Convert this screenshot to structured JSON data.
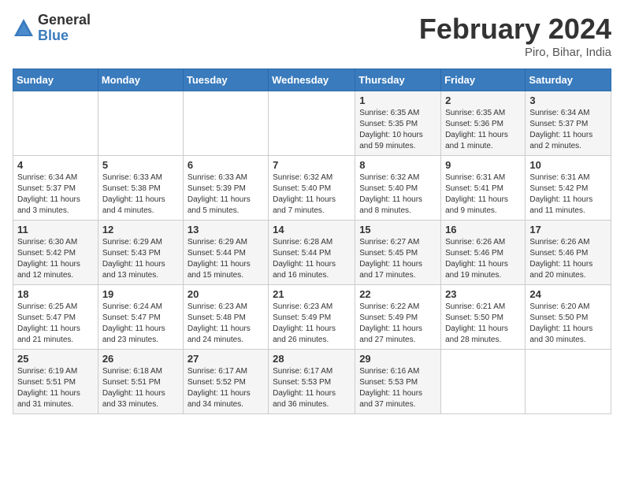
{
  "header": {
    "logo_general": "General",
    "logo_blue": "Blue",
    "title": "February 2024",
    "subtitle": "Piro, Bihar, India"
  },
  "days_of_week": [
    "Sunday",
    "Monday",
    "Tuesday",
    "Wednesday",
    "Thursday",
    "Friday",
    "Saturday"
  ],
  "weeks": [
    [
      {
        "day": "",
        "sunrise": "",
        "sunset": "",
        "daylight": ""
      },
      {
        "day": "",
        "sunrise": "",
        "sunset": "",
        "daylight": ""
      },
      {
        "day": "",
        "sunrise": "",
        "sunset": "",
        "daylight": ""
      },
      {
        "day": "",
        "sunrise": "",
        "sunset": "",
        "daylight": ""
      },
      {
        "day": "1",
        "sunrise": "Sunrise: 6:35 AM",
        "sunset": "Sunset: 5:35 PM",
        "daylight": "Daylight: 10 hours and 59 minutes."
      },
      {
        "day": "2",
        "sunrise": "Sunrise: 6:35 AM",
        "sunset": "Sunset: 5:36 PM",
        "daylight": "Daylight: 11 hours and 1 minute."
      },
      {
        "day": "3",
        "sunrise": "Sunrise: 6:34 AM",
        "sunset": "Sunset: 5:37 PM",
        "daylight": "Daylight: 11 hours and 2 minutes."
      }
    ],
    [
      {
        "day": "4",
        "sunrise": "Sunrise: 6:34 AM",
        "sunset": "Sunset: 5:37 PM",
        "daylight": "Daylight: 11 hours and 3 minutes."
      },
      {
        "day": "5",
        "sunrise": "Sunrise: 6:33 AM",
        "sunset": "Sunset: 5:38 PM",
        "daylight": "Daylight: 11 hours and 4 minutes."
      },
      {
        "day": "6",
        "sunrise": "Sunrise: 6:33 AM",
        "sunset": "Sunset: 5:39 PM",
        "daylight": "Daylight: 11 hours and 5 minutes."
      },
      {
        "day": "7",
        "sunrise": "Sunrise: 6:32 AM",
        "sunset": "Sunset: 5:40 PM",
        "daylight": "Daylight: 11 hours and 7 minutes."
      },
      {
        "day": "8",
        "sunrise": "Sunrise: 6:32 AM",
        "sunset": "Sunset: 5:40 PM",
        "daylight": "Daylight: 11 hours and 8 minutes."
      },
      {
        "day": "9",
        "sunrise": "Sunrise: 6:31 AM",
        "sunset": "Sunset: 5:41 PM",
        "daylight": "Daylight: 11 hours and 9 minutes."
      },
      {
        "day": "10",
        "sunrise": "Sunrise: 6:31 AM",
        "sunset": "Sunset: 5:42 PM",
        "daylight": "Daylight: 11 hours and 11 minutes."
      }
    ],
    [
      {
        "day": "11",
        "sunrise": "Sunrise: 6:30 AM",
        "sunset": "Sunset: 5:42 PM",
        "daylight": "Daylight: 11 hours and 12 minutes."
      },
      {
        "day": "12",
        "sunrise": "Sunrise: 6:29 AM",
        "sunset": "Sunset: 5:43 PM",
        "daylight": "Daylight: 11 hours and 13 minutes."
      },
      {
        "day": "13",
        "sunrise": "Sunrise: 6:29 AM",
        "sunset": "Sunset: 5:44 PM",
        "daylight": "Daylight: 11 hours and 15 minutes."
      },
      {
        "day": "14",
        "sunrise": "Sunrise: 6:28 AM",
        "sunset": "Sunset: 5:44 PM",
        "daylight": "Daylight: 11 hours and 16 minutes."
      },
      {
        "day": "15",
        "sunrise": "Sunrise: 6:27 AM",
        "sunset": "Sunset: 5:45 PM",
        "daylight": "Daylight: 11 hours and 17 minutes."
      },
      {
        "day": "16",
        "sunrise": "Sunrise: 6:26 AM",
        "sunset": "Sunset: 5:46 PM",
        "daylight": "Daylight: 11 hours and 19 minutes."
      },
      {
        "day": "17",
        "sunrise": "Sunrise: 6:26 AM",
        "sunset": "Sunset: 5:46 PM",
        "daylight": "Daylight: 11 hours and 20 minutes."
      }
    ],
    [
      {
        "day": "18",
        "sunrise": "Sunrise: 6:25 AM",
        "sunset": "Sunset: 5:47 PM",
        "daylight": "Daylight: 11 hours and 21 minutes."
      },
      {
        "day": "19",
        "sunrise": "Sunrise: 6:24 AM",
        "sunset": "Sunset: 5:47 PM",
        "daylight": "Daylight: 11 hours and 23 minutes."
      },
      {
        "day": "20",
        "sunrise": "Sunrise: 6:23 AM",
        "sunset": "Sunset: 5:48 PM",
        "daylight": "Daylight: 11 hours and 24 minutes."
      },
      {
        "day": "21",
        "sunrise": "Sunrise: 6:23 AM",
        "sunset": "Sunset: 5:49 PM",
        "daylight": "Daylight: 11 hours and 26 minutes."
      },
      {
        "day": "22",
        "sunrise": "Sunrise: 6:22 AM",
        "sunset": "Sunset: 5:49 PM",
        "daylight": "Daylight: 11 hours and 27 minutes."
      },
      {
        "day": "23",
        "sunrise": "Sunrise: 6:21 AM",
        "sunset": "Sunset: 5:50 PM",
        "daylight": "Daylight: 11 hours and 28 minutes."
      },
      {
        "day": "24",
        "sunrise": "Sunrise: 6:20 AM",
        "sunset": "Sunset: 5:50 PM",
        "daylight": "Daylight: 11 hours and 30 minutes."
      }
    ],
    [
      {
        "day": "25",
        "sunrise": "Sunrise: 6:19 AM",
        "sunset": "Sunset: 5:51 PM",
        "daylight": "Daylight: 11 hours and 31 minutes."
      },
      {
        "day": "26",
        "sunrise": "Sunrise: 6:18 AM",
        "sunset": "Sunset: 5:51 PM",
        "daylight": "Daylight: 11 hours and 33 minutes."
      },
      {
        "day": "27",
        "sunrise": "Sunrise: 6:17 AM",
        "sunset": "Sunset: 5:52 PM",
        "daylight": "Daylight: 11 hours and 34 minutes."
      },
      {
        "day": "28",
        "sunrise": "Sunrise: 6:17 AM",
        "sunset": "Sunset: 5:53 PM",
        "daylight": "Daylight: 11 hours and 36 minutes."
      },
      {
        "day": "29",
        "sunrise": "Sunrise: 6:16 AM",
        "sunset": "Sunset: 5:53 PM",
        "daylight": "Daylight: 11 hours and 37 minutes."
      },
      {
        "day": "",
        "sunrise": "",
        "sunset": "",
        "daylight": ""
      },
      {
        "day": "",
        "sunrise": "",
        "sunset": "",
        "daylight": ""
      }
    ]
  ]
}
